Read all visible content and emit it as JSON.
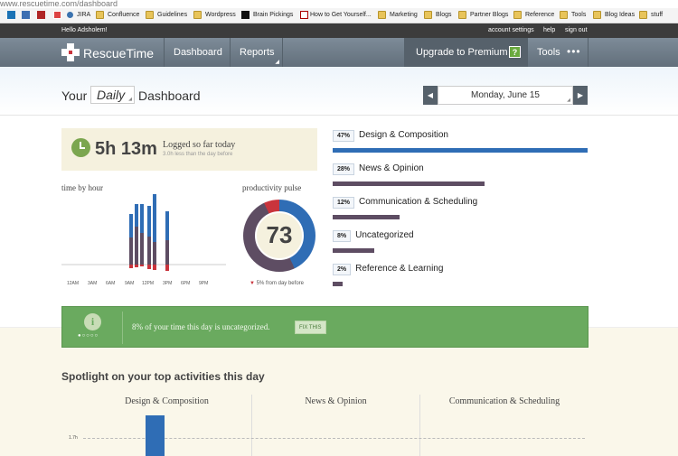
{
  "browser": {
    "url": "www.rescuetime.com/dashboard",
    "bookmarks": [
      "JIRA",
      "Confluence",
      "Guidelines",
      "Wordpress",
      "Brain Pickings",
      "How to Get Yourself...",
      "Marketing",
      "Blogs",
      "Partner Blogs",
      "Reference",
      "Tools",
      "Blog Ideas",
      "stuff"
    ]
  },
  "topbar": {
    "greeting": "Hello Adsholem!",
    "links": [
      "account settings",
      "help",
      "sign out"
    ]
  },
  "nav": {
    "logo": "RescueTime",
    "items": [
      "Dashboard",
      "Reports"
    ],
    "upgrade": "Upgrade to Premium",
    "upgrade_badge": "?",
    "tools": "Tools"
  },
  "header": {
    "title_prefix": "Your",
    "period": "Daily",
    "title_suffix": "Dashboard",
    "date": "Monday, June 15",
    "prev": "◀",
    "next": "▶"
  },
  "summary": {
    "time": "5h 13m",
    "label": "Logged so far today",
    "sub": "3.0h less than the day before"
  },
  "time_by_hour": {
    "title": "time by hour",
    "ticks": [
      "12AM",
      "3AM",
      "6AM",
      "9AM",
      "12PM",
      "3PM",
      "6PM",
      "9PM"
    ]
  },
  "pulse": {
    "title": "productivity pulse",
    "score": "73",
    "delta": "5% from day before"
  },
  "categories": [
    {
      "pct": "47%",
      "name": "Design & Composition",
      "value": 47,
      "color": "#2f6db5"
    },
    {
      "pct": "28%",
      "name": "News & Opinion",
      "value": 28,
      "color": "#5e4d63"
    },
    {
      "pct": "12%",
      "name": "Communication & Scheduling",
      "value": 12,
      "color": "#5e4d63"
    },
    {
      "pct": "8%",
      "name": "Uncategorized",
      "value": 8,
      "color": "#5e4d63"
    },
    {
      "pct": "2%",
      "name": "Reference & Learning",
      "value": 2,
      "color": "#5e4d63"
    }
  ],
  "alert": {
    "text": "8% of your time this day is uncategorized.",
    "button": "FIX THIS"
  },
  "spotlight": {
    "title": "Spotlight on your top activities this day",
    "columns": [
      "Design & Composition",
      "News & Opinion",
      "Communication & Scheduling"
    ],
    "axis_label": "1.7h"
  }
}
